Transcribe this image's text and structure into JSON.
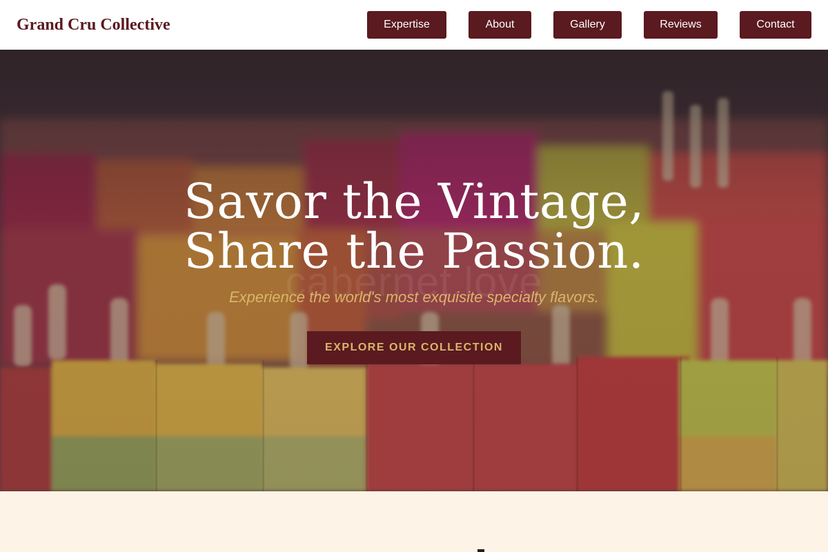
{
  "header": {
    "brand": "Grand Cru Collective",
    "nav": [
      "Expertise",
      "About",
      "Gallery",
      "Reviews",
      "Contact"
    ]
  },
  "hero": {
    "title_line1": "Savor the Vintage,",
    "title_line2": "Share the Passion.",
    "watermark": "cabernet.love",
    "subtitle": "Experience the world's most exquisite specialty flavors.",
    "cta_label": "EXPLORE OUR COLLECTION",
    "background_image": "colorful-popsicles-photo"
  },
  "colors": {
    "brand": "#5a1a1f",
    "accent_gold": "#d9b56a",
    "cream": "#fdf3e6",
    "header_bg": "#ffffff"
  }
}
